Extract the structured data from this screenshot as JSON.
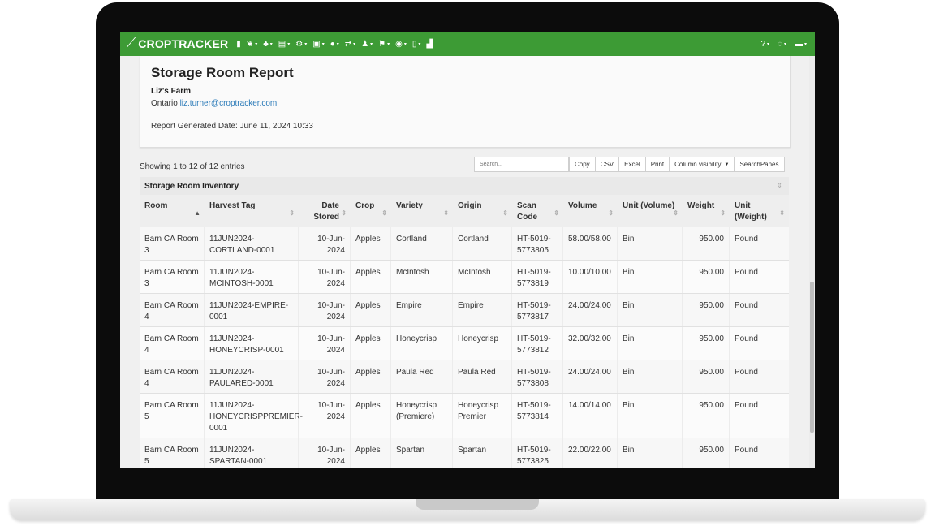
{
  "app": {
    "name": "CROPTRACKER",
    "brand_color": "#3d9b35",
    "nav_icons": [
      "bookmark-icon",
      "leaf-icon",
      "plant-icon",
      "document-icon",
      "gear-icon",
      "tractor-icon",
      "user-icon",
      "transfer-icon",
      "worker-icon",
      "flag-icon",
      "location-icon",
      "phone-icon",
      "chart-icon"
    ],
    "right_icons": [
      "help-icon",
      "support-icon",
      "briefcase-icon"
    ]
  },
  "report": {
    "title": "Storage Room Report",
    "farm_name": "Liz's Farm",
    "location": "Ontario",
    "email": "liz.turner@croptracker.com",
    "generated": "Report Generated Date: June 11, 2024 10:33"
  },
  "table_controls": {
    "showing": "Showing 1 to 12 of 12 entries",
    "search_placeholder": "Search...",
    "buttons": {
      "copy": "Copy",
      "csv": "CSV",
      "excel": "Excel",
      "print": "Print",
      "column_visibility": "Column visibility",
      "searchpanes": "SearchPanes"
    }
  },
  "inventory": {
    "title": "Storage Room Inventory",
    "columns": {
      "room": "Room",
      "tag": "Harvest Tag",
      "date": "Date Stored",
      "crop": "Crop",
      "variety": "Variety",
      "origin": "Origin",
      "scan": "Scan Code",
      "volume": "Volume",
      "unit_vol": "Unit (Volume)",
      "weight": "Weight",
      "unit_wt": "Unit (Weight)"
    },
    "rows": [
      {
        "room": "Barn CA Room 3",
        "tag": "11JUN2024-CORTLAND-0001",
        "date": "10-Jun-2024",
        "crop": "Apples",
        "variety": "Cortland",
        "origin": "Cortland",
        "scan": "HT-5019-5773805",
        "volume": "58.00/58.00",
        "unit_vol": "Bin",
        "weight": "950.00",
        "unit_wt": "Pound"
      },
      {
        "room": "Barn CA Room 3",
        "tag": "11JUN2024-MCINTOSH-0001",
        "date": "10-Jun-2024",
        "crop": "Apples",
        "variety": "McIntosh",
        "origin": "McIntosh",
        "scan": "HT-5019-5773819",
        "volume": "10.00/10.00",
        "unit_vol": "Bin",
        "weight": "950.00",
        "unit_wt": "Pound"
      },
      {
        "room": "Barn CA Room 4",
        "tag": "11JUN2024-EMPIRE-0001",
        "date": "10-Jun-2024",
        "crop": "Apples",
        "variety": "Empire",
        "origin": "Empire",
        "scan": "HT-5019-5773817",
        "volume": "24.00/24.00",
        "unit_vol": "Bin",
        "weight": "950.00",
        "unit_wt": "Pound"
      },
      {
        "room": "Barn CA Room 4",
        "tag": "11JUN2024-HONEYCRISP-0001",
        "date": "10-Jun-2024",
        "crop": "Apples",
        "variety": "Honeycrisp",
        "origin": "Honeycrisp",
        "scan": "HT-5019-5773812",
        "volume": "32.00/32.00",
        "unit_vol": "Bin",
        "weight": "950.00",
        "unit_wt": "Pound"
      },
      {
        "room": "Barn CA Room 4",
        "tag": "11JUN2024-PAULARED-0001",
        "date": "10-Jun-2024",
        "crop": "Apples",
        "variety": "Paula Red",
        "origin": "Paula Red",
        "scan": "HT-5019-5773808",
        "volume": "24.00/24.00",
        "unit_vol": "Bin",
        "weight": "950.00",
        "unit_wt": "Pound"
      },
      {
        "room": "Barn CA Room 5",
        "tag": "11JUN2024-HONEYCRISPPREMIER-0001",
        "date": "10-Jun-2024",
        "crop": "Apples",
        "variety": "Honeycrisp (Premiere)",
        "origin": "Honeycrisp Premier",
        "scan": "HT-5019-5773814",
        "volume": "14.00/14.00",
        "unit_vol": "Bin",
        "weight": "950.00",
        "unit_wt": "Pound"
      },
      {
        "room": "Barn CA Room 5",
        "tag": "11JUN2024-SPARTAN-0001",
        "date": "10-Jun-2024",
        "crop": "Apples",
        "variety": "Spartan",
        "origin": "Spartan",
        "scan": "HT-5019-5773825",
        "volume": "22.00/22.00",
        "unit_vol": "Bin",
        "weight": "950.00",
        "unit_wt": "Pound"
      }
    ]
  }
}
